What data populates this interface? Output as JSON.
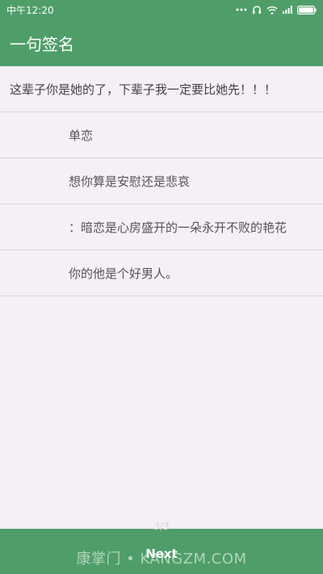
{
  "status_bar": {
    "time": "中午12:20"
  },
  "app_bar": {
    "title": "一句签名"
  },
  "list": {
    "headline": "这辈子你是她的了，下辈子我一定要比她先！！！",
    "items": [
      "单恋",
      "想你算是安慰还是悲哀",
      "：暗恋是心房盛开的一朵永开不败的艳花",
      "你的他是个好男人。"
    ]
  },
  "footer": {
    "page_indicator": "3/3",
    "next_label": "Next",
    "watermark": "康掌门 • KANGZM.COM"
  },
  "colors": {
    "primary": "#4f9e69",
    "background": "#f5eff7",
    "divider": "#dcd6dd"
  }
}
